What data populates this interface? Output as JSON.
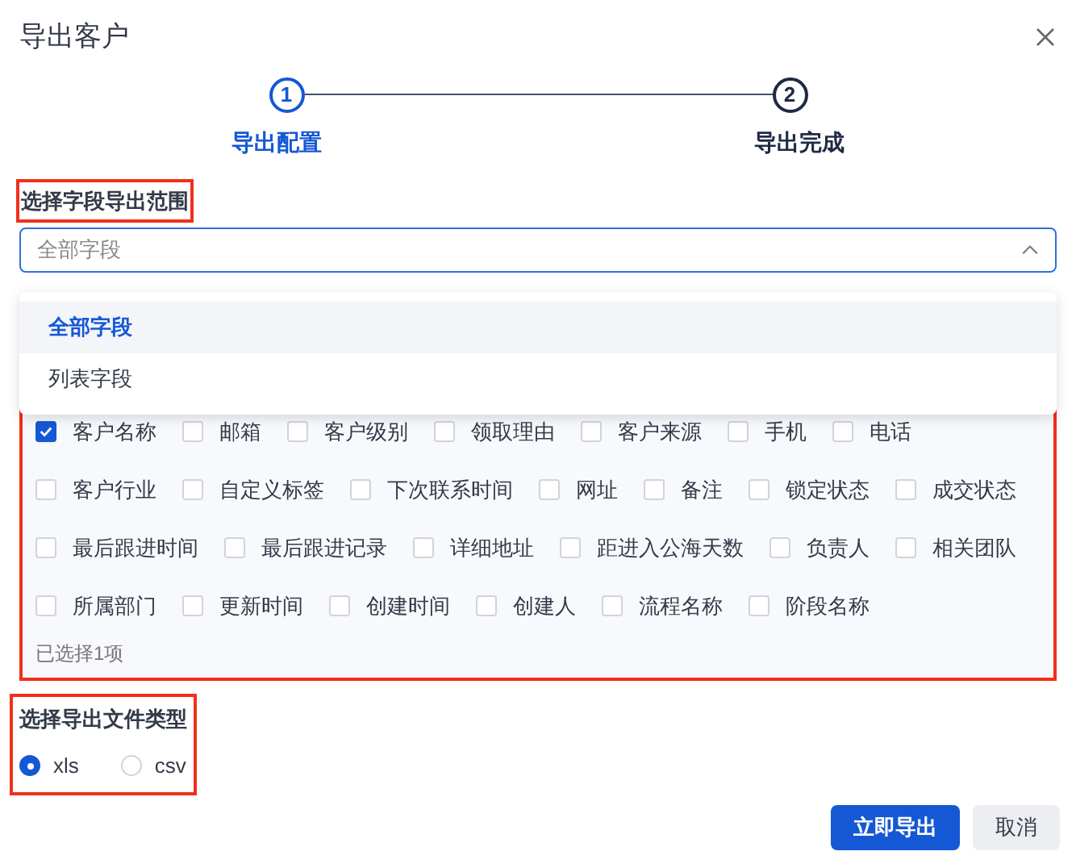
{
  "dialog": {
    "title": "导出客户"
  },
  "steps": [
    {
      "number": "1",
      "label": "导出配置",
      "selected": true
    },
    {
      "number": "2",
      "label": "导出完成",
      "selected": false
    }
  ],
  "field_range": {
    "label": "选择字段导出范围",
    "highlighted": true,
    "value": "全部字段",
    "expanded": true,
    "options": [
      {
        "label": "全部字段",
        "selected": true
      },
      {
        "label": "列表字段",
        "selected": false
      }
    ]
  },
  "fields": {
    "highlighted": true,
    "items": [
      {
        "label": "客户名称",
        "checked": true
      },
      {
        "label": "邮箱",
        "checked": false
      },
      {
        "label": "客户级别",
        "checked": false
      },
      {
        "label": "领取理由",
        "checked": false
      },
      {
        "label": "客户来源",
        "checked": false
      },
      {
        "label": "手机",
        "checked": false
      },
      {
        "label": "电话",
        "checked": false
      },
      {
        "label": "客户行业",
        "checked": false
      },
      {
        "label": "自定义标签",
        "checked": false
      },
      {
        "label": "下次联系时间",
        "checked": false
      },
      {
        "label": "网址",
        "checked": false
      },
      {
        "label": "备注",
        "checked": false
      },
      {
        "label": "锁定状态",
        "checked": false
      },
      {
        "label": "成交状态",
        "checked": false
      },
      {
        "label": "最后跟进时间",
        "checked": false
      },
      {
        "label": "最后跟进记录",
        "checked": false
      },
      {
        "label": "详细地址",
        "checked": false
      },
      {
        "label": "距进入公海天数",
        "checked": false
      },
      {
        "label": "负责人",
        "checked": false
      },
      {
        "label": "相关团队",
        "checked": false
      },
      {
        "label": "所属部门",
        "checked": false
      },
      {
        "label": "更新时间",
        "checked": false
      },
      {
        "label": "创建时间",
        "checked": false
      },
      {
        "label": "创建人",
        "checked": false
      },
      {
        "label": "流程名称",
        "checked": false
      },
      {
        "label": "阶段名称",
        "checked": false
      }
    ],
    "summary": "已选择1项"
  },
  "file_type": {
    "label": "选择导出文件类型",
    "highlighted": true,
    "options": [
      {
        "label": "xls",
        "selected": true
      },
      {
        "label": "csv",
        "selected": false
      }
    ]
  },
  "buttons": [
    {
      "label": "立即导出",
      "kind": "primary"
    },
    {
      "label": "取消",
      "kind": "secondary"
    }
  ]
}
